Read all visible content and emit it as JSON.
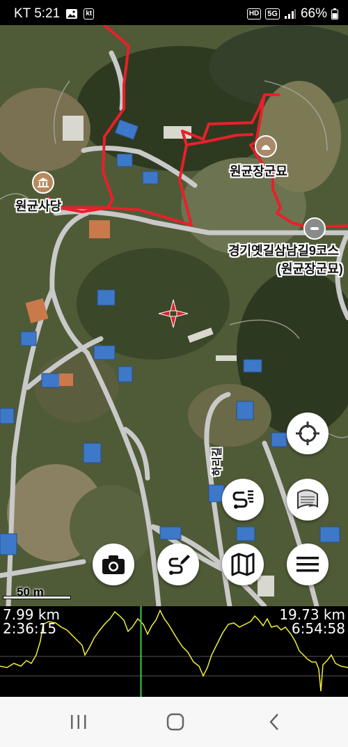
{
  "status_bar": {
    "carrier_time": "KT 5:21",
    "gallery_icon": "image-icon",
    "kt_badge": "kt",
    "hd_badge": "HD",
    "network": "5G",
    "battery": "66%"
  },
  "map": {
    "labels": {
      "tomb_name": "원균장군묘",
      "shrine_name": "원균사당",
      "trail_line1": "경기옛길삼남길9코스",
      "trail_line2": "(원균장군묘)",
      "road_name": "하리길"
    },
    "scale_label": "50 m",
    "colors": {
      "track": "#e8202a",
      "road": "#c9c9c9",
      "crosshair": "#d8232a"
    }
  },
  "buttons": {
    "locate": "crosshair-target-icon",
    "route_list": "route-list-icon",
    "map_layers": "layers-icon",
    "camera": "camera-icon",
    "draw_route": "route-edit-icon",
    "map": "map-icon",
    "menu": "hamburger-menu-icon"
  },
  "elevation_profile": {
    "distance_current": "7.99 km",
    "time_current": "2:36:15",
    "distance_total": "19.73 km",
    "time_total": "6:54:58",
    "cursor_position": 0.405,
    "colors": {
      "line": "#f2ef3a",
      "cursor": "#35d04a"
    }
  },
  "nav_bar": {
    "recents": "recents-icon",
    "home": "home-icon",
    "back": "back-icon"
  }
}
